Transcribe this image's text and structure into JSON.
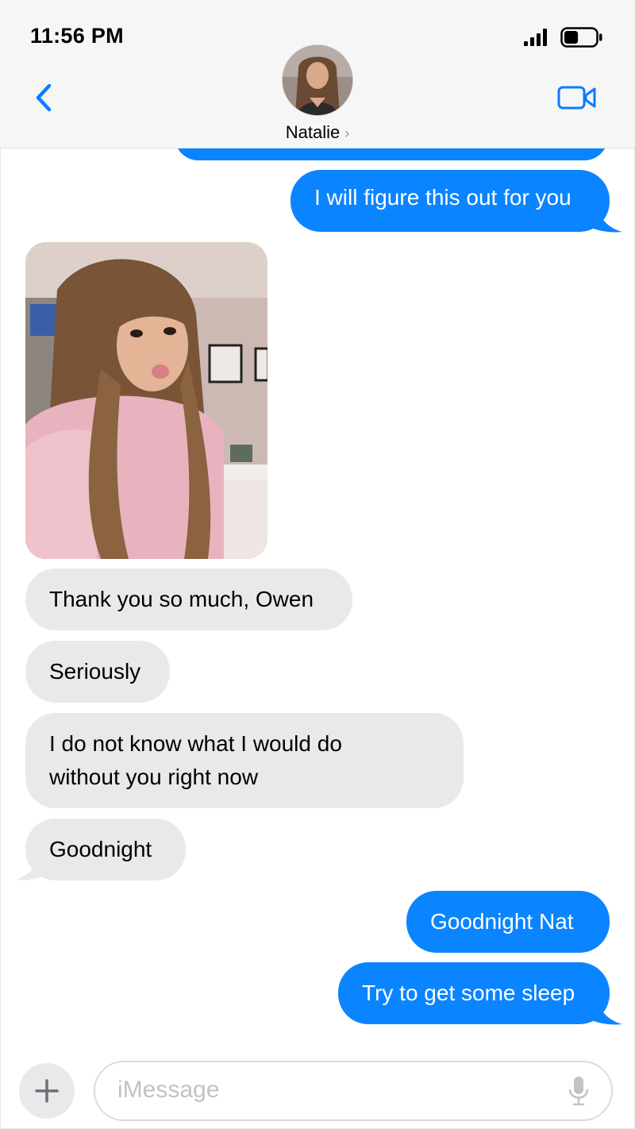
{
  "status_bar": {
    "time": "11:56 PM"
  },
  "header": {
    "contact_name": "Natalie",
    "chevron": "›"
  },
  "messages": [
    {
      "id": "m1",
      "direction": "outgoing",
      "text": "I will figure this out for you"
    },
    {
      "id": "m2",
      "direction": "incoming",
      "type": "photo"
    },
    {
      "id": "m3",
      "direction": "incoming",
      "text": "Thank you so much, Owen"
    },
    {
      "id": "m4",
      "direction": "incoming",
      "text": "Seriously"
    },
    {
      "id": "m5",
      "direction": "incoming",
      "lines": [
        "I do not know what I would do",
        "without you right now"
      ]
    },
    {
      "id": "m6",
      "direction": "incoming",
      "text": "Goodnight"
    },
    {
      "id": "m7",
      "direction": "outgoing",
      "text": "Goodnight Nat"
    },
    {
      "id": "m8",
      "direction": "outgoing",
      "text": "Try to get some sleep"
    }
  ],
  "composer": {
    "placeholder": "iMessage"
  },
  "icons": {
    "back": "chevron-left-icon",
    "video": "video-camera-icon",
    "plus": "plus-icon",
    "mic": "microphone-icon",
    "signal": "signal-icon",
    "battery": "battery-icon"
  },
  "colors": {
    "outgoing_bubble": "#0b84ff",
    "incoming_bubble": "#e9e9eb",
    "accent": "#0a7cff",
    "header_bg": "#f6f6f6"
  },
  "battery_level": 0.45
}
